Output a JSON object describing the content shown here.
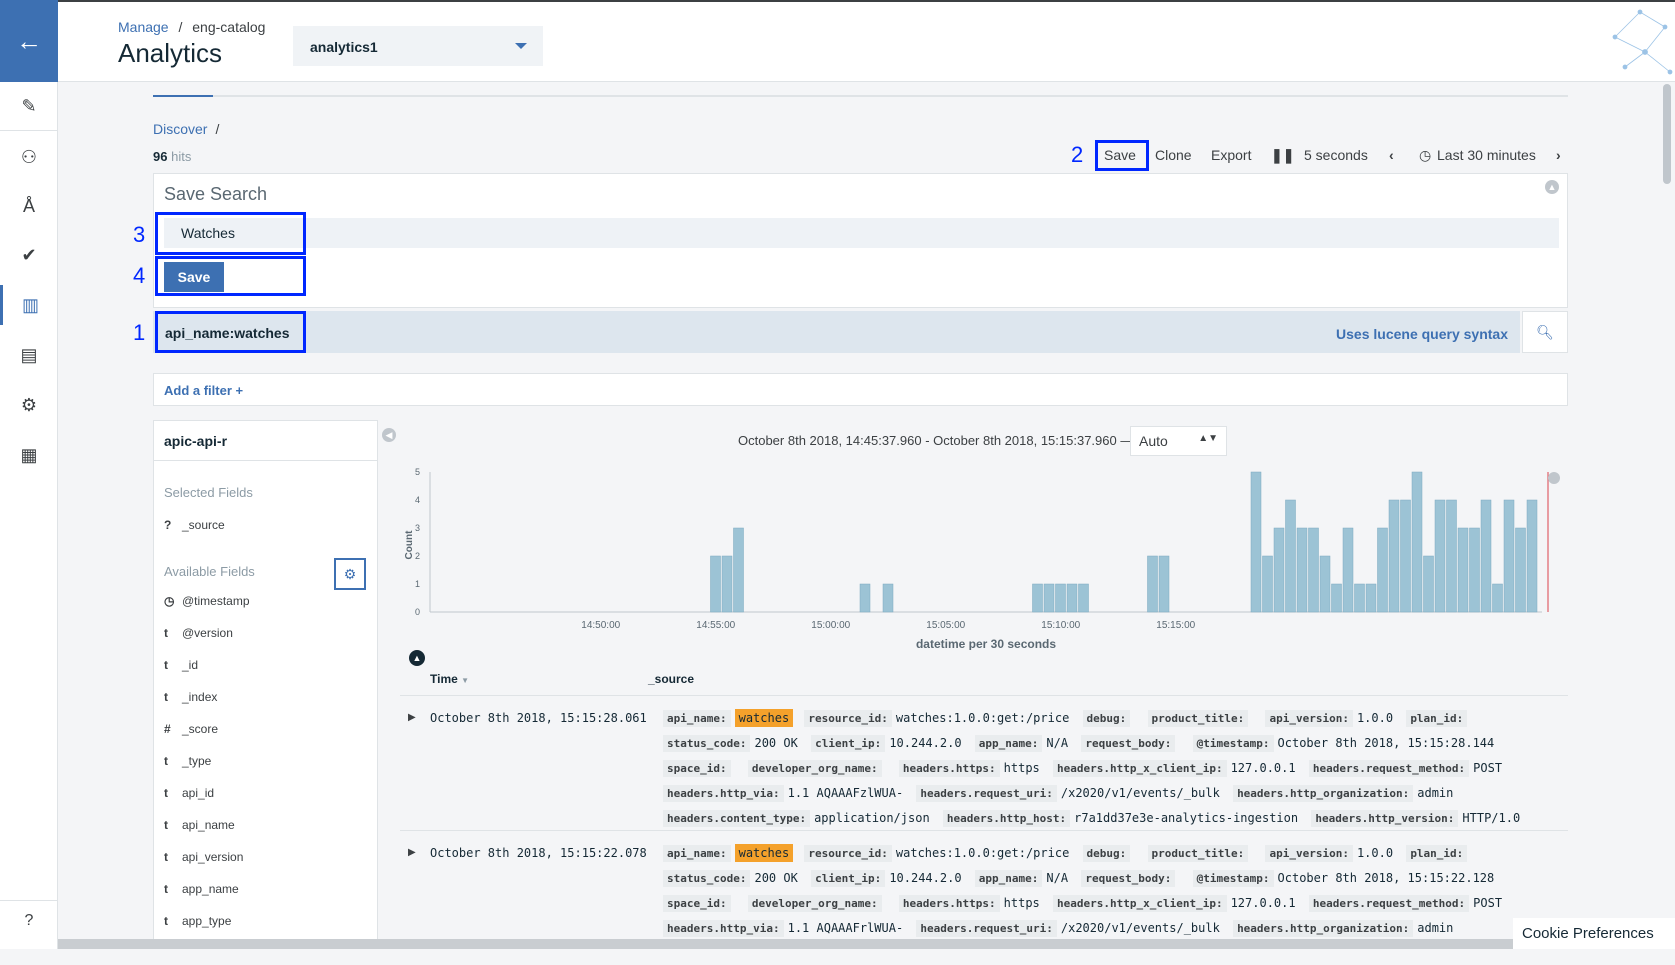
{
  "breadcrumb": {
    "manage": "Manage",
    "sep": "/",
    "catalog": "eng-catalog"
  },
  "title": "Analytics",
  "select": {
    "value": "analytics1"
  },
  "discover": {
    "label": "Discover",
    "sep": "/"
  },
  "hits": {
    "count": "96",
    "label": "hits"
  },
  "toolbar": {
    "save": "Save",
    "clone": "Clone",
    "export": "Export",
    "interval": "5 seconds",
    "range": "Last 30 minutes"
  },
  "annotations": {
    "n1": "1",
    "n2": "2",
    "n3": "3",
    "n4": "4"
  },
  "save_panel": {
    "title": "Save Search",
    "input_value": "Watches",
    "save_button": "Save"
  },
  "query": {
    "value": "api_name:watches",
    "hint": "Uses lucene query syntax"
  },
  "filter": {
    "label": "Add a filter +"
  },
  "sidebar": {
    "index": "apic-api-r",
    "selected_title": "Selected Fields",
    "selected": [
      {
        "type": "?",
        "name": "_source"
      }
    ],
    "available_title": "Available Fields",
    "available": [
      {
        "type": "◷",
        "name": "@timestamp"
      },
      {
        "type": "t",
        "name": "@version"
      },
      {
        "type": "t",
        "name": "_id"
      },
      {
        "type": "t",
        "name": "_index"
      },
      {
        "type": "#",
        "name": "_score"
      },
      {
        "type": "t",
        "name": "_type"
      },
      {
        "type": "t",
        "name": "api_id"
      },
      {
        "type": "t",
        "name": "api_name"
      },
      {
        "type": "t",
        "name": "api_version"
      },
      {
        "type": "t",
        "name": "app_name"
      },
      {
        "type": "t",
        "name": "app_type"
      }
    ]
  },
  "histogram_header": {
    "range": "October 8th 2018, 14:45:37.960 - October 8th 2018, 15:15:37.960 —",
    "interval": "Auto"
  },
  "chart_data": {
    "type": "bar",
    "xlabel": "datetime per 30 seconds",
    "ylabel": "Count",
    "ylim": [
      0,
      5
    ],
    "yticks": [
      "0",
      "1",
      "2",
      "3",
      "4",
      "5"
    ],
    "xticks": [
      "14:50:00",
      "14:55:00",
      "15:00:00",
      "15:05:00",
      "15:10:00",
      "15:15:00"
    ],
    "values": [
      0,
      0,
      0,
      0,
      0,
      0,
      0,
      0,
      0,
      0,
      0,
      0,
      0,
      0,
      0,
      0,
      0,
      0,
      0,
      0,
      0,
      0,
      0,
      0,
      2,
      2,
      3,
      0,
      0,
      0,
      0,
      0,
      0,
      0,
      0,
      0,
      0,
      1,
      0,
      1,
      0,
      0,
      0,
      0,
      0,
      0,
      0,
      0,
      0,
      0,
      0,
      0,
      1,
      1,
      1,
      1,
      1,
      0,
      0,
      0,
      0,
      0,
      2,
      2,
      0,
      0,
      0,
      0,
      0,
      0,
      0,
      5,
      2,
      3,
      4,
      3,
      3,
      2,
      1,
      3,
      1,
      1,
      3,
      4,
      4,
      5,
      2,
      4,
      4,
      3,
      3,
      4,
      1,
      4,
      3,
      4
    ],
    "bar_color": "#9cc3d5",
    "marker_color": "#e0616a"
  },
  "results": {
    "col_time": "Time",
    "col_source": "_source",
    "rows": [
      {
        "time": "October 8th 2018, 15:15:28.061",
        "fields": [
          [
            "api_name:",
            "watches",
            true
          ],
          [
            "resource_id:",
            "watches:1.0.0:get:/price",
            false
          ],
          [
            "debug:",
            "",
            false
          ],
          [
            "product_title:",
            "",
            false
          ],
          [
            "api_version:",
            "1.0.0",
            false
          ],
          [
            "plan_id:",
            "",
            false
          ],
          [
            "status_code:",
            "200 OK",
            false
          ],
          [
            "client_ip:",
            "10.244.2.0",
            false
          ],
          [
            "app_name:",
            "N/A",
            false
          ],
          [
            "request_body:",
            "",
            false
          ],
          [
            "@timestamp:",
            "October 8th 2018, 15:15:28.144",
            false
          ],
          [
            "space_id:",
            "",
            false
          ],
          [
            "developer_org_name:",
            "",
            false
          ],
          [
            "headers.https:",
            "https",
            false
          ],
          [
            "headers.http_x_client_ip:",
            "127.0.0.1",
            false
          ],
          [
            "headers.request_method:",
            "POST",
            false
          ],
          [
            "headers.http_via:",
            "1.1 AQAAAFzlWUA-",
            false
          ],
          [
            "headers.request_uri:",
            "/x2020/v1/events/_bulk",
            false
          ],
          [
            "headers.http_organization:",
            "admin",
            false
          ],
          [
            "headers.content_type:",
            "application/json",
            false
          ],
          [
            "headers.http_host:",
            "r7a1dd37e3e-analytics-ingestion",
            false
          ],
          [
            "headers.http_version:",
            "HTTP/1.0",
            false
          ]
        ]
      },
      {
        "time": "October 8th 2018, 15:15:22.078",
        "fields": [
          [
            "api_name:",
            "watches",
            true
          ],
          [
            "resource_id:",
            "watches:1.0.0:get:/price",
            false
          ],
          [
            "debug:",
            "",
            false
          ],
          [
            "product_title:",
            "",
            false
          ],
          [
            "api_version:",
            "1.0.0",
            false
          ],
          [
            "plan_id:",
            "",
            false
          ],
          [
            "status_code:",
            "200 OK",
            false
          ],
          [
            "client_ip:",
            "10.244.2.0",
            false
          ],
          [
            "app_name:",
            "N/A",
            false
          ],
          [
            "request_body:",
            "",
            false
          ],
          [
            "@timestamp:",
            "October 8th 2018, 15:15:22.128",
            false
          ],
          [
            "space_id:",
            "",
            false
          ],
          [
            "developer_org_name:",
            "",
            false
          ],
          [
            "headers.https:",
            "https",
            false
          ],
          [
            "headers.http_x_client_ip:",
            "127.0.0.1",
            false
          ],
          [
            "headers.request_method:",
            "POST",
            false
          ],
          [
            "headers.http_via:",
            "1.1 AQAAAFrlWUA-",
            false
          ],
          [
            "headers.request_uri:",
            "/x2020/v1/events/_bulk",
            false
          ],
          [
            "headers.http_organization:",
            "admin",
            false
          ]
        ]
      }
    ]
  },
  "cookie": "Cookie Preferences"
}
